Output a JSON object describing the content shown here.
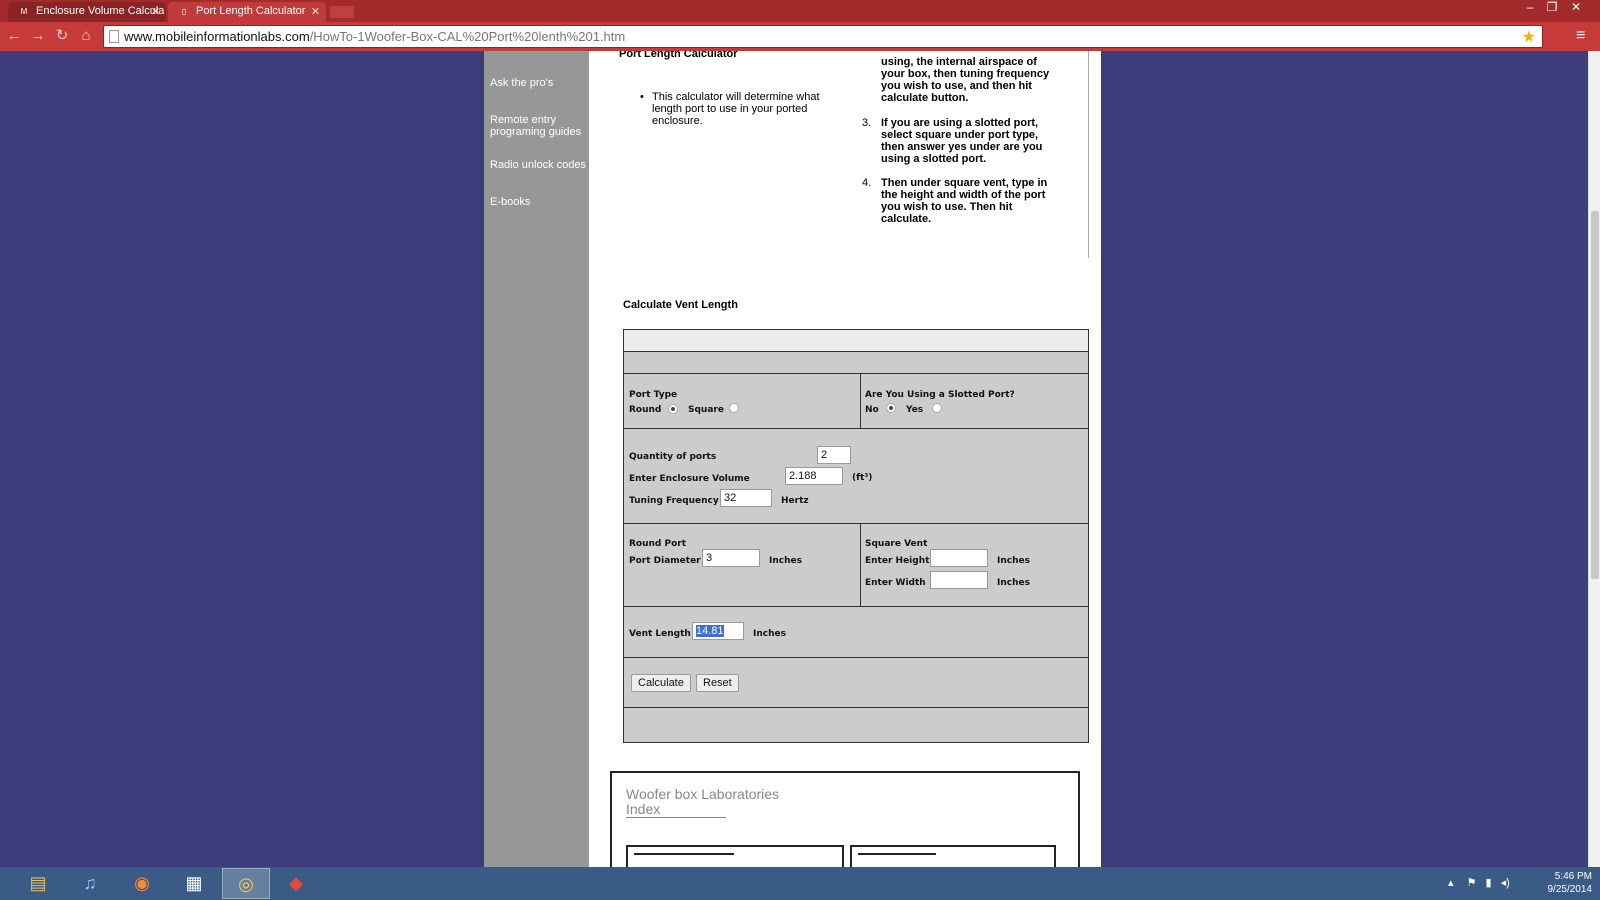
{
  "browser": {
    "tabs": [
      {
        "label": "Enclosure Volume Calcula",
        "favicon": "M"
      },
      {
        "label": "Port Length Calculator"
      }
    ],
    "url_domain": "www.mobileinformationlabs.com",
    "url_path": "/HowTo-1Woofer-Box-CAL%20Port%20lenth%201.htm"
  },
  "sidebar": {
    "items": [
      {
        "label": "Ask the pro's"
      },
      {
        "label": "Remote entry programing guides"
      },
      {
        "label": "Radio unlock codes"
      },
      {
        "label": "E-books"
      }
    ]
  },
  "intro": {
    "title": "Port Length Calculator",
    "bullet": "This calculator will determine what length port to use in your ported enclosure."
  },
  "instructions": {
    "step2": "using, the internal airspace of your box, then tuning frequency you wish to use, and then hit calculate button.",
    "step3_num": "3.",
    "step3": "If you are using a slotted port, select square under port type, then answer yes under are you using a slotted port.",
    "step4_num": "4.",
    "step4": "Then under square vent, type in the height and width of the port you wish to use. Then hit calculate."
  },
  "calculator": {
    "heading": "Calculate Vent Length",
    "port_type_label": "Port Type",
    "round_label": "Round",
    "square_label": "Square",
    "slotted_label": "Are You Using a Slotted Port?",
    "no_label": "No",
    "yes_label": "Yes",
    "quantity_label": "Quantity of ports",
    "quantity_value": "2",
    "volume_label": "Enter Enclosure Volume",
    "volume_value": "2.188",
    "volume_unit": "(ft³)",
    "tuning_label": "Tuning Frequency",
    "tuning_value": "32",
    "tuning_unit": "Hertz",
    "round_port_label": "Round Port",
    "diameter_label": "Port Diameter",
    "diameter_value": "3",
    "diameter_unit": "Inches",
    "square_vent_label": "Square Vent",
    "height_label": "Enter Height",
    "height_value": "",
    "height_unit": "Inches",
    "width_label": "Enter Width",
    "width_value": "",
    "width_unit": "Inches",
    "vent_length_label": "Vent Length",
    "vent_length_value": "14.81",
    "vent_length_unit": "Inches",
    "calculate_button": "Calculate",
    "reset_button": "Reset"
  },
  "footer": {
    "title_line1": "Woofer box Laboratories",
    "title_line2": "Index"
  },
  "taskbar": {
    "time": "5:46 PM",
    "date": "9/25/2014"
  },
  "colors": {
    "page_background": "#3d3c7c",
    "sidebar": "#979797",
    "browser_chrome": "#c63a3a",
    "calculator_panel": "#cccccc",
    "selection": "#3a6fd8"
  }
}
